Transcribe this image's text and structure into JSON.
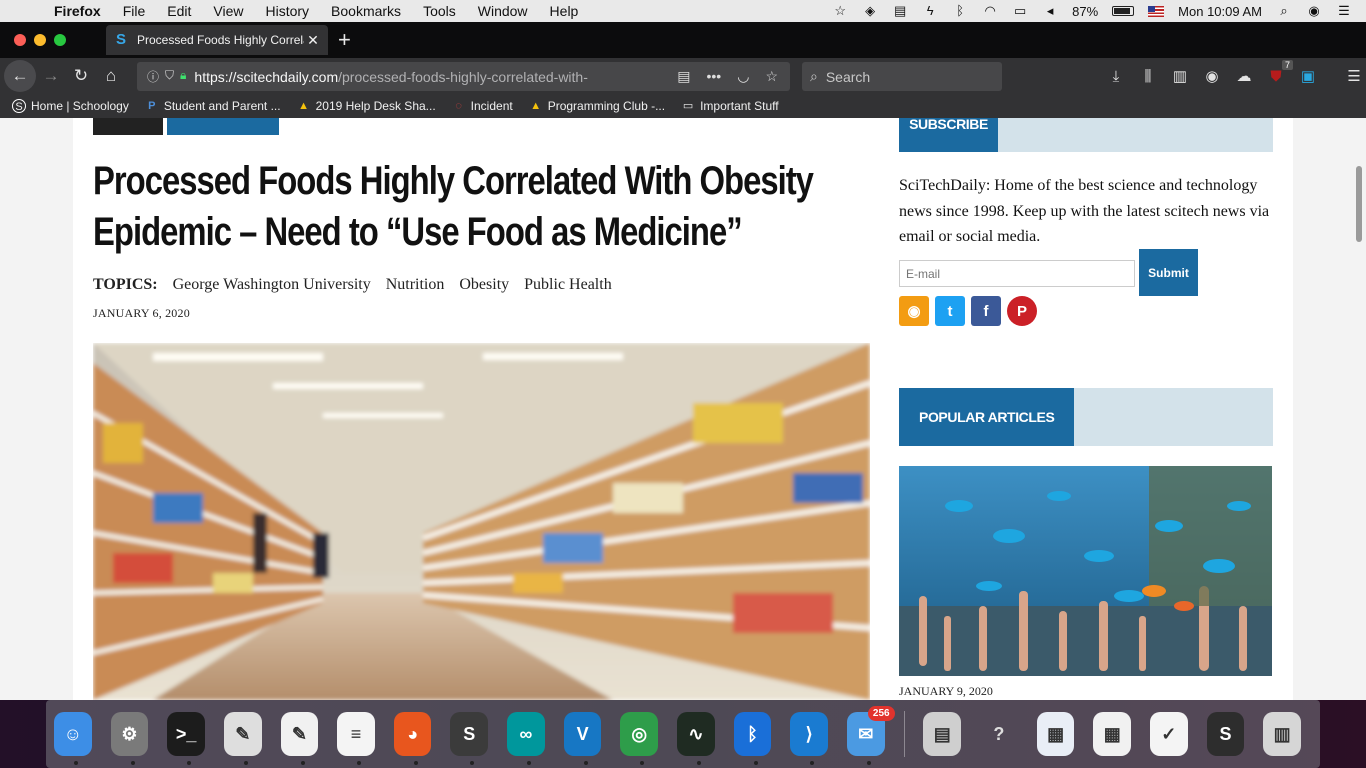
{
  "menubar": {
    "app": "Firefox",
    "items": [
      "File",
      "Edit",
      "View",
      "History",
      "Bookmarks",
      "Tools",
      "Window",
      "Help"
    ],
    "battery": "87%",
    "clock": "Mon 10:09 AM"
  },
  "tab": {
    "title": "Processed Foods Highly Correla",
    "favicon": "S"
  },
  "navbar": {
    "url_host": "https://scitechdaily.com",
    "url_path": "/processed-foods-highly-correlated-with-",
    "search_placeholder": "Search",
    "badge": "7"
  },
  "bookmarks": [
    {
      "label": "Home | Schoology",
      "icon": "schoology-icon",
      "glyph": "S"
    },
    {
      "label": "Student and Parent ...",
      "icon": "powerschool-icon",
      "glyph": "P"
    },
    {
      "label": "2019 Help Desk Sha...",
      "icon": "drive-icon",
      "glyph": "▲"
    },
    {
      "label": "Incident",
      "icon": "incident-icon",
      "glyph": "◌"
    },
    {
      "label": "Programming Club -...",
      "icon": "drive-icon",
      "glyph": "▲"
    },
    {
      "label": "Important Stuff",
      "icon": "folder-icon",
      "glyph": "▭"
    }
  ],
  "article": {
    "headline_line1": "Processed Foods Highly Correlated With Obesity",
    "headline_line2": "Epidemic – Need to “Use Food as Medicine”",
    "topics_label": "TOPICS:",
    "topics": [
      "George Washington University",
      "Nutrition",
      "Obesity",
      "Public Health"
    ],
    "date": "JANUARY 6, 2020"
  },
  "sidebar": {
    "subscribe_title": "SUBSCRIBE",
    "subscribe_text": "SciTechDaily: Home of the best science and technology news since 1998. Keep up with the latest scitech news via email or social media.",
    "email_placeholder": "E-mail",
    "submit_label": "Submit",
    "social": [
      {
        "name": "rss-icon",
        "glyph": "◉",
        "color": "#f39c12"
      },
      {
        "name": "twitter-icon",
        "glyph": "t",
        "color": "#1da1f2"
      },
      {
        "name": "facebook-icon",
        "glyph": "f",
        "color": "#3b5998"
      },
      {
        "name": "pinterest-icon",
        "glyph": "P",
        "color": "#cb2027"
      }
    ],
    "popular_title": "POPULAR ARTICLES",
    "popular_date": "JANUARY 9, 2020"
  },
  "dock": {
    "apps": [
      {
        "name": "finder-icon",
        "bg": "#3d8ee6",
        "glyph": "☺"
      },
      {
        "name": "system-preferences-icon",
        "bg": "#7a7a7a",
        "glyph": "⚙"
      },
      {
        "name": "terminal-icon",
        "bg": "#1c1c1c",
        "glyph": ">_"
      },
      {
        "name": "script-editor-icon",
        "bg": "#dedede",
        "glyph": "✎"
      },
      {
        "name": "textedit-icon",
        "bg": "#f1f1f1",
        "glyph": "✎"
      },
      {
        "name": "notes-icon",
        "bg": "#f4f4f4",
        "glyph": "≡"
      },
      {
        "name": "firefox-icon",
        "bg": "#e8561e",
        "glyph": "◕"
      },
      {
        "name": "sublime-icon",
        "bg": "#3b3b3b",
        "glyph": "S"
      },
      {
        "name": "arduino-icon",
        "bg": "#00979c",
        "glyph": "∞"
      },
      {
        "name": "vnc-icon",
        "bg": "#1777c4",
        "glyph": "V"
      },
      {
        "name": "chrome-icon",
        "bg": "#2e9d4a",
        "glyph": "◎"
      },
      {
        "name": "activity-monitor-icon",
        "bg": "#1f2b22",
        "glyph": "∿"
      },
      {
        "name": "bluetooth-icon",
        "bg": "#1a6fd8",
        "glyph": "ᛒ"
      },
      {
        "name": "vscode-icon",
        "bg": "#1a7bd1",
        "glyph": "⟩"
      },
      {
        "name": "mail-icon",
        "bg": "#4b9ae2",
        "glyph": "✉",
        "badge": "256"
      }
    ],
    "others": [
      {
        "name": "disk-utility-icon",
        "bg": "#cfcfcf",
        "glyph": "▤"
      },
      {
        "name": "help-icon",
        "bg": "transparent",
        "glyph": "?"
      },
      {
        "name": "spaces-icon",
        "bg": "#e9eef6",
        "glyph": "▦"
      },
      {
        "name": "window-icon",
        "bg": "#f1f1f1",
        "glyph": "▦"
      },
      {
        "name": "checklist-icon",
        "bg": "#f4f4f4",
        "glyph": "✓"
      },
      {
        "name": "sublime-window-icon",
        "bg": "#2d2d2d",
        "glyph": "S"
      },
      {
        "name": "trash-icon",
        "bg": "#d6d6d6",
        "glyph": "▥"
      }
    ]
  }
}
